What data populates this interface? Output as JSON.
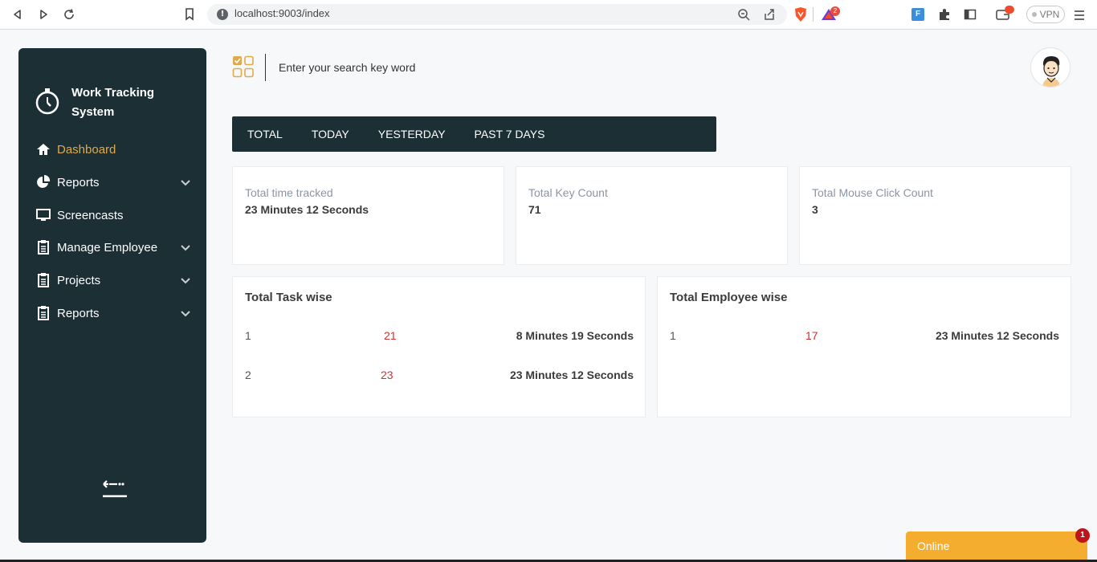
{
  "browser": {
    "url": "localhost:9003/index",
    "vpn_label": "VPN",
    "notification_count": "2",
    "extension_label": "F"
  },
  "sidebar": {
    "brand_title": "Work Tracking System",
    "items": [
      {
        "label": "Dashboard",
        "icon": "home-icon",
        "active": true,
        "has_chevron": false
      },
      {
        "label": "Reports",
        "icon": "pie-chart-icon",
        "active": false,
        "has_chevron": true
      },
      {
        "label": "Screencasts",
        "icon": "monitor-icon",
        "active": false,
        "has_chevron": false
      },
      {
        "label": "Manage Employee",
        "icon": "clipboard-icon",
        "active": false,
        "has_chevron": true
      },
      {
        "label": "Projects",
        "icon": "clipboard-icon",
        "active": false,
        "has_chevron": true
      },
      {
        "label": "Reports",
        "icon": "clipboard-icon",
        "active": false,
        "has_chevron": true
      }
    ],
    "collapse_icon": "collapse-left-icon"
  },
  "header": {
    "search_placeholder": "Enter your search key word"
  },
  "tabs": [
    {
      "label": "TOTAL"
    },
    {
      "label": "TODAY"
    },
    {
      "label": "YESTERDAY"
    },
    {
      "label": "PAST 7 DAYS"
    }
  ],
  "stats": [
    {
      "label": "Total time tracked",
      "value": "23 Minutes 12 Seconds"
    },
    {
      "label": "Total Key Count",
      "value": "71"
    },
    {
      "label": "Total Mouse Click Count",
      "value": "3"
    }
  ],
  "task_wise": {
    "title": "Total Task wise",
    "rows": [
      {
        "index": "1",
        "id": "21",
        "duration": "8 Minutes 19 Seconds"
      },
      {
        "index": "2",
        "id": "23",
        "duration": "23 Minutes 12 Seconds"
      }
    ]
  },
  "employee_wise": {
    "title": "Total Employee wise",
    "rows": [
      {
        "index": "1",
        "id": "17",
        "duration": "23 Minutes 12 Seconds"
      }
    ]
  },
  "online_widget": {
    "label": "Online",
    "badge": "1"
  },
  "colors": {
    "sidebar_bg": "#1b2f35",
    "accent": "#e0a94a",
    "online_bg": "#f5ad2f",
    "id_red": "#d0312d"
  }
}
